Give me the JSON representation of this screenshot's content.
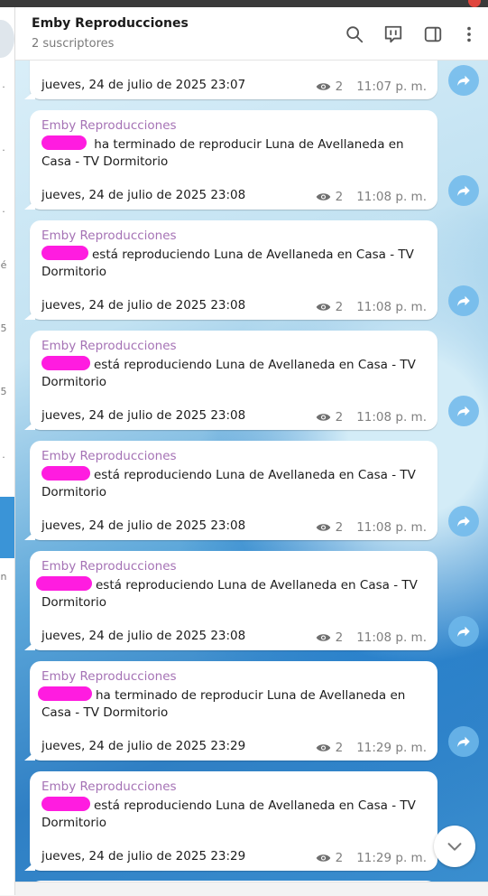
{
  "header": {
    "title": "Emby Reproducciones",
    "subtitle": "2 suscriptores",
    "icons": [
      "search-icon",
      "live-stream-icon",
      "sidebar-toggle-icon",
      "more-vert-icon"
    ]
  },
  "messages": [
    {
      "sender": "",
      "text": "",
      "date": "jueves, 24 de julio de 2025 23:07",
      "views": "2",
      "time": "11:07 p. m."
    },
    {
      "sender": "Emby Reproducciones",
      "text": " ha terminado de reproducir Luna de Avellaneda en Casa - TV Dormitorio",
      "date": "jueves, 24 de julio de 2025 23:08",
      "views": "2",
      "time": "11:08 p. m."
    },
    {
      "sender": "Emby Reproducciones",
      "text": "está reproduciendo Luna de Avellaneda en Casa - TV Dormitorio",
      "date": "jueves, 24 de julio de 2025 23:08",
      "views": "2",
      "time": "11:08 p. m."
    },
    {
      "sender": "Emby Reproducciones",
      "text": "está reproduciendo Luna de Avellaneda en Casa - TV Dormitorio",
      "date": "jueves, 24 de julio de 2025 23:08",
      "views": "2",
      "time": "11:08 p. m."
    },
    {
      "sender": "Emby Reproducciones",
      "text": "está reproduciendo Luna de Avellaneda en Casa - TV Dormitorio",
      "date": "jueves, 24 de julio de 2025 23:08",
      "views": "2",
      "time": "11:08 p. m."
    },
    {
      "sender": "Emby Reproducciones",
      "text": "está reproduciendo Luna de Avellaneda en Casa - TV Dormitorio",
      "date": "jueves, 24 de julio de 2025 23:08",
      "views": "2",
      "time": "11:08 p. m."
    },
    {
      "sender": "Emby Reproducciones",
      "text": "ha terminado de reproducir Luna de Avellaneda en Casa - TV Dormitorio",
      "date": "jueves, 24 de julio de 2025 23:29",
      "views": "2",
      "time": "11:29 p. m."
    },
    {
      "sender": "Emby Reproducciones",
      "text": "está reproduciendo Luna de Avellaneda en Casa - TV Dormitorio",
      "date": "jueves, 24 de julio de 2025 23:29",
      "views": "2",
      "time": "11:29 p. m."
    }
  ],
  "colors": {
    "sender": "#a572b5",
    "redaction": "#ff1ce0",
    "forward_button": "#6eb9eb"
  }
}
